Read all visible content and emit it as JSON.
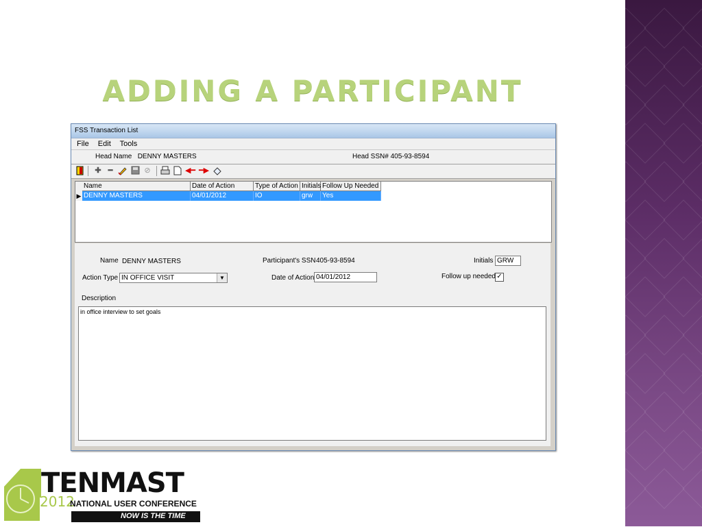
{
  "slide": {
    "title": "ADDING A PARTICIPANT"
  },
  "window": {
    "title": "FSS Transaction List",
    "menu": [
      "File",
      "Edit",
      "Tools"
    ],
    "head_name_label": "Head Name",
    "head_name": "DENNY MASTERS",
    "head_ssn_label": "Head SSN#",
    "head_ssn": "405-93-8594"
  },
  "toolbar": {
    "icons": [
      "exit-icon",
      "add-icon",
      "remove-icon",
      "edit-icon",
      "save-icon",
      "cancel-icon",
      "print-icon",
      "new-document-icon",
      "previous-icon",
      "next-icon",
      "eraser-icon"
    ]
  },
  "grid": {
    "columns": [
      "Name",
      "Date of Action",
      "Type of Action",
      "Initials",
      "Follow Up Needed"
    ],
    "rows": [
      [
        "DENNY MASTERS",
        "04/01/2012",
        "IO",
        "grw",
        "Yes"
      ]
    ]
  },
  "form": {
    "name_label": "Name",
    "name_value": "DENNY MASTERS",
    "ssn_label": "Participant's SSN",
    "ssn_value": "405-93-8594",
    "initials_label": "Initials",
    "initials_value": "GRW",
    "action_type_label": "Action Type",
    "action_type_value": "IN OFFICE VISIT",
    "date_label": "Date of Action",
    "date_value": "04/01/2012",
    "followup_label": "Follow up needed",
    "followup_checked": true,
    "description_label": "Description",
    "description_value": "in office interview to set goals"
  },
  "logo": {
    "brand": "TENMAST",
    "year": "2012",
    "line1": "NATIONAL USER CONFERENCE",
    "line2": "NOW IS THE TIME"
  },
  "colors": {
    "title": "#b7d37b",
    "selection": "#3399ff",
    "accent_purple": "#5c2d66",
    "logo_green": "#a8c84a"
  }
}
